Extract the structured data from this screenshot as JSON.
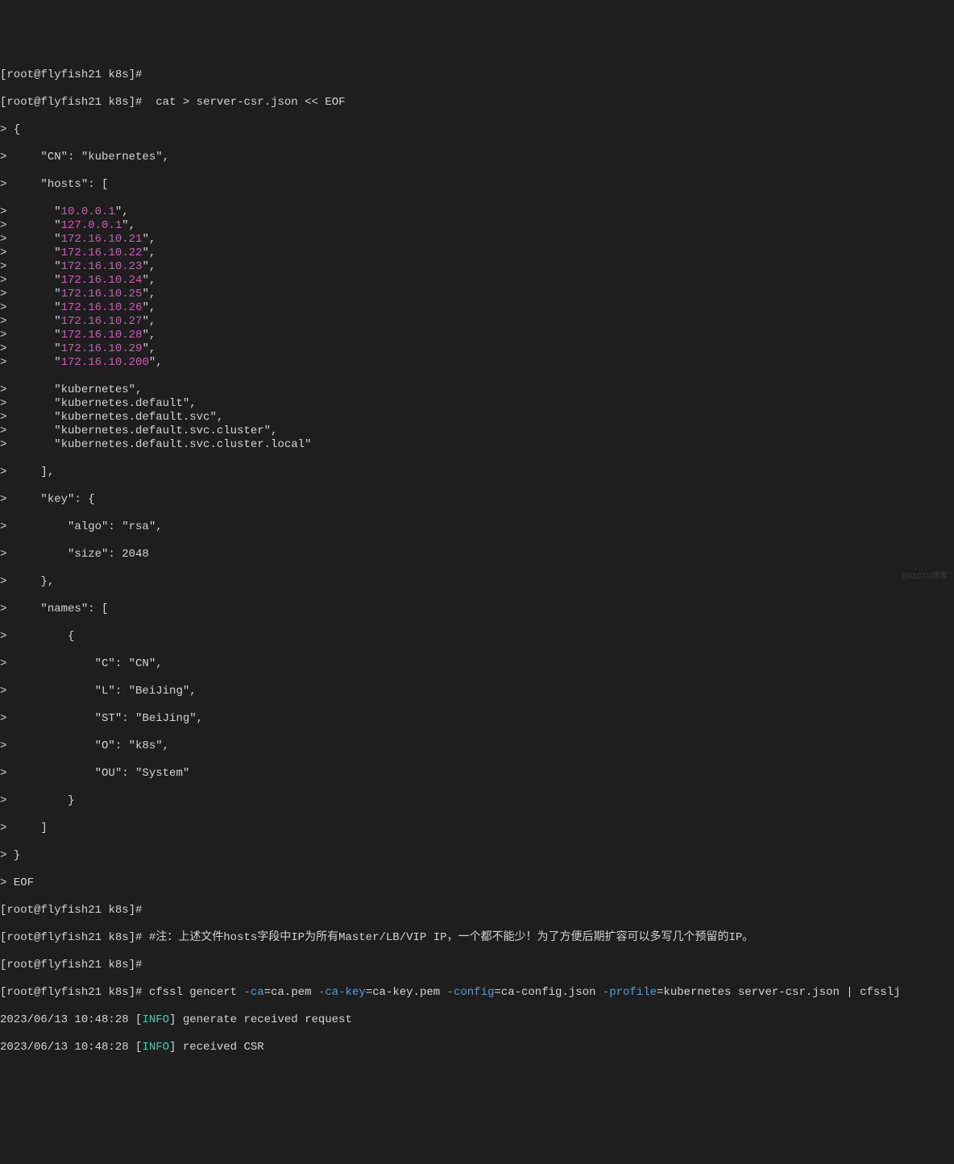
{
  "prompt": {
    "user": "root@flyfish21",
    "dir": "k8s",
    "bracket_open": "[",
    "bracket_close": "]",
    "hash": "#"
  },
  "line0_partial": "[root@flyfish21 k8s]#",
  "line1_cmd": " cat > server-csr.json << EOF",
  "heredoc": {
    "open_brace": " {",
    "cn_line": "     \"CN\": \"kubernetes\",",
    "hosts_open": "     \"hosts\": [",
    "hosts_ips": [
      {
        "pre": "       \"",
        "ip": "10.0.0.1",
        "post": "\","
      },
      {
        "pre": "       \"",
        "ip": "127.0.0.1",
        "post": "\","
      },
      {
        "pre": "       \"",
        "ip": "172.16.10.21",
        "post": "\","
      },
      {
        "pre": "       \"",
        "ip": "172.16.10.22",
        "post": "\","
      },
      {
        "pre": "       \"",
        "ip": "172.16.10.23",
        "post": "\","
      },
      {
        "pre": "       \"",
        "ip": "172.16.10.24",
        "post": "\","
      },
      {
        "pre": "       \"",
        "ip": "172.16.10.25",
        "post": "\","
      },
      {
        "pre": "       \"",
        "ip": "172.16.10.26",
        "post": "\","
      },
      {
        "pre": "       \"",
        "ip": "172.16.10.27",
        "post": "\","
      },
      {
        "pre": "       \"",
        "ip": "172.16.10.28",
        "post": "\","
      },
      {
        "pre": "       \"",
        "ip": "172.16.10.29",
        "post": "\","
      },
      {
        "pre": "       \"",
        "ip": "172.16.10.200",
        "post": "\","
      }
    ],
    "hosts_names": [
      "       \"kubernetes\",",
      "       \"kubernetes.default\",",
      "       \"kubernetes.default.svc\",",
      "       \"kubernetes.default.svc.cluster\",",
      "       \"kubernetes.default.svc.cluster.local\""
    ],
    "hosts_close": "     ],",
    "key_open": "     \"key\": {",
    "key_algo": "         \"algo\": \"rsa\",",
    "key_size": "         \"size\": 2048",
    "key_close": "     },",
    "names_open": "     \"names\": [",
    "names_brace_open": "         {",
    "names_c": "             \"C\": \"CN\",",
    "names_l": "             \"L\": \"BeiJing\",",
    "names_st": "             \"ST\": \"BeiJing\",",
    "names_o": "             \"O\": \"k8s\",",
    "names_ou": "             \"OU\": \"System\"",
    "names_brace_close": "         }",
    "names_close": "     ]",
    "close_brace": " }",
    "eof": " EOF"
  },
  "gt": ">",
  "note_line": " #注：上述文件hosts字段中IP为所有Master/LB/VIP IP，一个都不能少！为了方便后期扩容可以多写几个预留的IP。",
  "cfssl": {
    "cmd": " cfssl gencert ",
    "flag1": "-ca",
    "val1": "=ca.pem ",
    "flag2": "-ca-key",
    "val2": "=ca-key.pem ",
    "flag3": "-config",
    "val3": "=ca-config.json ",
    "flag4": "-profile",
    "val4": "=kubernetes server-csr.json | cfsslj"
  },
  "log": {
    "ts1": "2023/06/13 10:48:28 [",
    "info": "INFO",
    "msg1": "] generate received request",
    "ts2": "2023/06/13 10:48:28 [",
    "msg2": "] received CSR"
  },
  "watermark": "@51CTO博客"
}
